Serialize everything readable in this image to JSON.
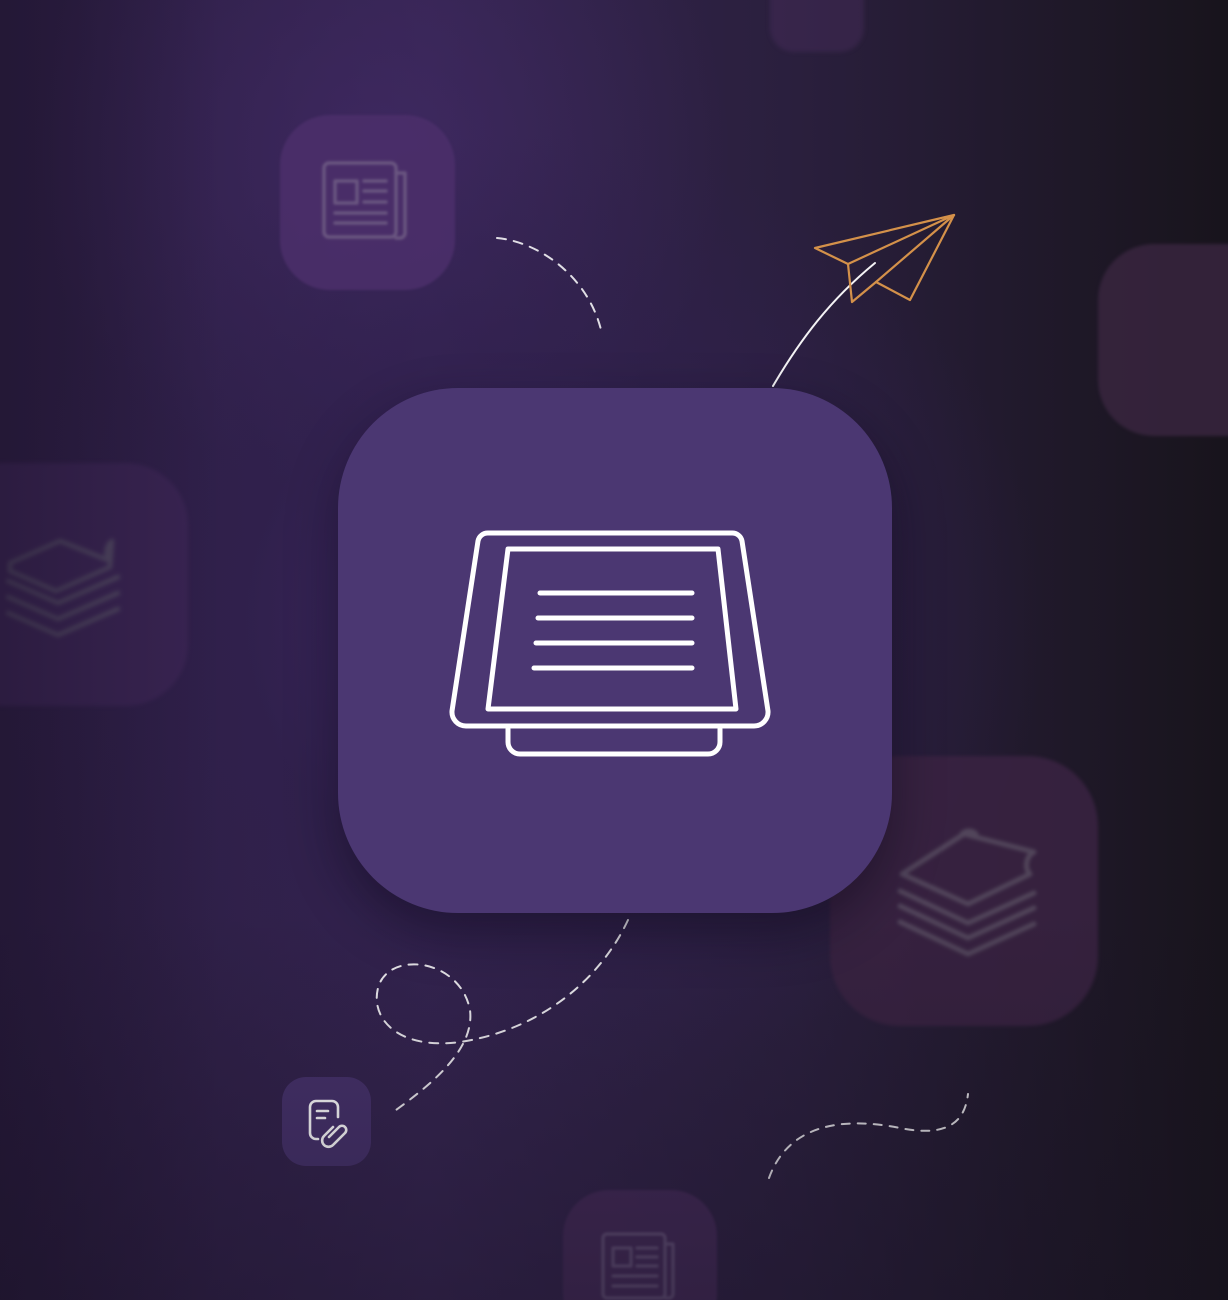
{
  "scene": {
    "background_colors": [
      "#2a1c40",
      "#34244f",
      "#18141c"
    ],
    "accent_color": "#d4914a",
    "line_color": "#ffffff",
    "main_tile_color": "#4b3772"
  },
  "icons": {
    "main": "tablet-stand-icon",
    "news_top": "newspaper-icon",
    "news_bottom": "newspaper-icon",
    "layers_left": "layers-icon",
    "layers_right": "layers-icon",
    "doc_small": "document-attachment-icon",
    "plane": "paper-plane-icon"
  }
}
